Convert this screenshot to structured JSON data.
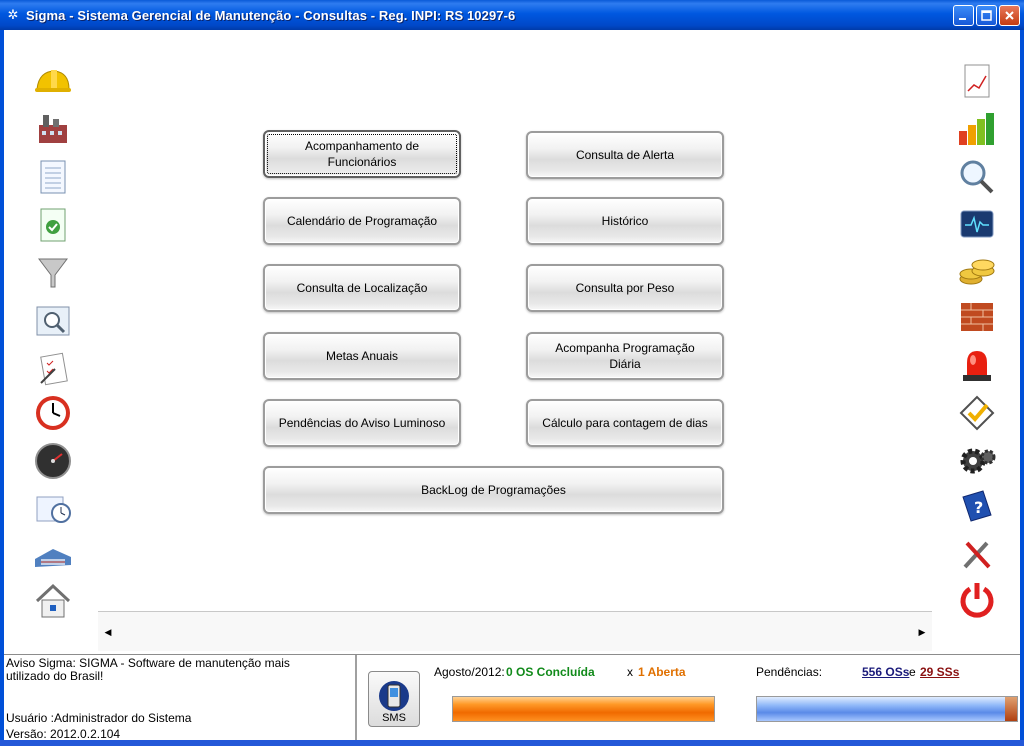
{
  "window": {
    "title": "Sigma - Sistema Gerencial de Manutenção - Consultas - Reg. INPI: RS 10297-6",
    "controls": [
      "minimize",
      "maximize",
      "close"
    ]
  },
  "left_icons": [
    "hard-hat-icon",
    "factory-icon",
    "document-list-icon",
    "document-check-icon",
    "funnel-icon",
    "magnifier-window-icon",
    "checklist-pen-icon",
    "clock-icon",
    "speedometer-icon",
    "schedule-clock-icon",
    "warehouse-icon",
    "home-icon"
  ],
  "right_icons": [
    "report-chart-icon",
    "bar-chart-icon",
    "search-glass-icon",
    "monitor-pulse-icon",
    "coins-icon",
    "bricks-icon",
    "alarm-light-icon",
    "checkmark-icon",
    "gears-icon",
    "help-book-icon",
    "tools-icon",
    "power-icon"
  ],
  "buttons": {
    "acompanhamento_funcionarios": "Acompanhamento de Funcionários",
    "consulta_alerta": "Consulta de Alerta",
    "calendario_programacao": "Calendário de Programação",
    "historico": "Histórico",
    "consulta_localizacao": "Consulta de Localização",
    "consulta_peso": "Consulta por Peso",
    "metas_anuais": "Metas Anuais",
    "acompanha_programacao": "Acompanha Programação Diária",
    "pendencias_aviso": "Pendências do Aviso Luminoso",
    "calculo_contagem": "Cálculo para contagem de dias",
    "backlog": "BackLog de Programações"
  },
  "status": {
    "aviso": "Aviso Sigma: SIGMA - Software de manutenção mais utilizado do Brasil!",
    "usuario": "Usuário :Administrador do Sistema",
    "versao": "Versão: 2012.0.2.104",
    "sms_label": "SMS",
    "month_label": "Agosto/2012:",
    "os_concluida": "0 OS Concluída",
    "x_label": "x",
    "aberta": "1 Aberta",
    "pendencias_label": "Pendências:",
    "oss": "556 OSs",
    "e_label": "e",
    "sss": "29 SSs"
  },
  "colors": {
    "titlebar": "#0058e0",
    "concluida": "#118a1a",
    "aberta": "#e07000",
    "oss": "#1a1a7a",
    "sss": "#8a1010"
  }
}
